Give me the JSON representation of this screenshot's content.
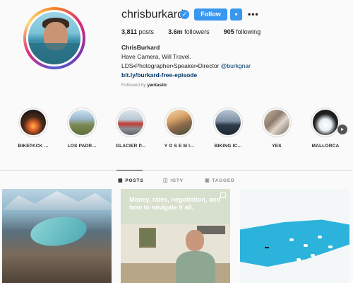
{
  "profile": {
    "username": "chrisburkard",
    "follow_label": "Follow",
    "dropdown_glyph": "▾",
    "more_glyph": "•••",
    "verified_glyph": "✓",
    "stats": {
      "posts_count": "3,811",
      "posts_label": "posts",
      "followers_count": "3.6m",
      "followers_label": "followers",
      "following_count": "905",
      "following_label": "following"
    },
    "bio": {
      "name": "ChrisBurkard",
      "line1": "Have Camera, Will Travel.",
      "line2_prefix": "LDS•Photographer•Speaker•Director ",
      "line2_mention": "@burkgnar",
      "link": "bit.ly/burkard-free-episode"
    },
    "followed_by_prefix": "Followed by ",
    "followed_by_user": "yantastic"
  },
  "highlights": [
    {
      "label": "BIKEPACK ..."
    },
    {
      "label": "LOS PADR..."
    },
    {
      "label": "GLACIER P..."
    },
    {
      "label": "Y O S E M I..."
    },
    {
      "label": "BIKING IC..."
    },
    {
      "label": "YES"
    },
    {
      "label": "MALLORCA"
    }
  ],
  "next_glyph": "▸",
  "tabs": [
    {
      "label": "POSTS",
      "icon": "grid-icon",
      "glyph": "▦",
      "active": true
    },
    {
      "label": "IGTV",
      "icon": "tv-icon",
      "glyph": "◫",
      "active": false
    },
    {
      "label": "TAGGED",
      "icon": "tag-icon",
      "glyph": "▣",
      "active": false
    }
  ],
  "posts": [
    {
      "caption": ""
    },
    {
      "caption": "Money, rates, negotiation, and how to navigate it all."
    },
    {
      "caption": ""
    }
  ],
  "colors": {
    "accent": "#3897f0",
    "link": "#003569",
    "text": "#262626",
    "muted": "#8e8e8e",
    "background": "#fafafa"
  }
}
